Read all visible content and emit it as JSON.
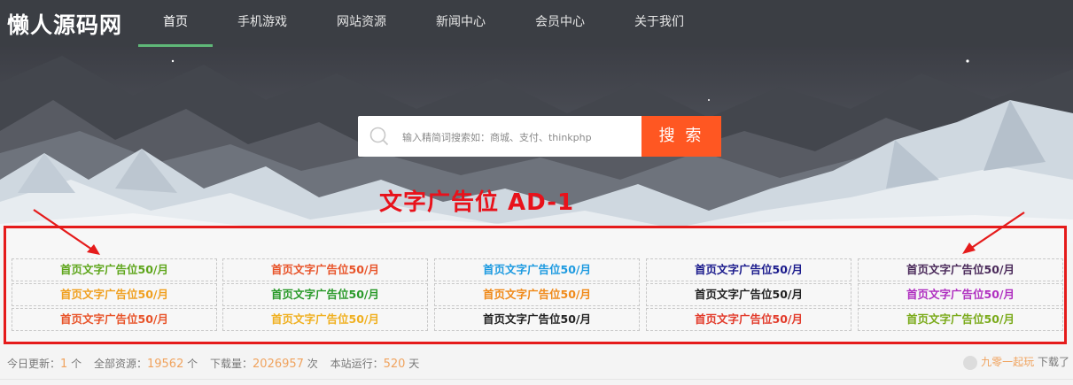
{
  "header": {
    "logo": "懒人源码网",
    "nav": [
      {
        "label": "首页",
        "active": true
      },
      {
        "label": "手机游戏"
      },
      {
        "label": "网站资源"
      },
      {
        "label": "新闻中心"
      },
      {
        "label": "会员中心"
      },
      {
        "label": "关于我们"
      }
    ]
  },
  "search": {
    "placeholder": "输入精简词搜索如：商城、支付、thinkphp",
    "button_label": "搜 索"
  },
  "ad_section": {
    "heading": "文字广告位 AD-1",
    "rows": [
      [
        {
          "text": "首页文字广告位50/月",
          "color": "#5fa61c"
        },
        {
          "text": "首页文字广告位50/月",
          "color": "#e8542a"
        },
        {
          "text": "首页文字广告位50/月",
          "color": "#1c9ae0"
        },
        {
          "text": "首页文字广告位50/月",
          "color": "#1a1a8c"
        },
        {
          "text": "首页文字广告位50/月",
          "color": "#4a2a5a"
        }
      ],
      [
        {
          "text": "首页文字广告位50/月",
          "color": "#f0a020"
        },
        {
          "text": "首页文字广告位50/月",
          "color": "#2a9a2a"
        },
        {
          "text": "首页文字广告位50/月",
          "color": "#f08a1a"
        },
        {
          "text": "首页文字广告位50/月",
          "color": "#222222"
        },
        {
          "text": "首页文字广告位50/月",
          "color": "#b030c0"
        }
      ],
      [
        {
          "text": "首页文字广告位50/月",
          "color": "#e8542a"
        },
        {
          "text": "首页文字广告位50/月",
          "color": "#f0b020"
        },
        {
          "text": "首页文字广告位50/月",
          "color": "#222222"
        },
        {
          "text": "首页文字广告位50/月",
          "color": "#e23a2a"
        },
        {
          "text": "首页文字广告位50/月",
          "color": "#7aaa1a"
        }
      ]
    ]
  },
  "stats": {
    "today_label": "今日更新：",
    "today_value": "1",
    "today_unit": "个",
    "total_label": "全部资源：",
    "total_value": "19562",
    "total_unit": "个",
    "downloads_label": "下载量：",
    "downloads_value": "2026957",
    "downloads_unit": "次",
    "uptime_label": "本站运行：",
    "uptime_value": "520",
    "uptime_unit": "天"
  },
  "recent_user": {
    "name": "九零一起玩",
    "action": "下载了"
  },
  "colors": {
    "nav_bg": "#3b3e44",
    "nav_active_underline": "#5fb878",
    "search_button": "#ff5722",
    "ad_border": "#e51b1b",
    "annotation_red": "#e8121b",
    "stat_number": "#f0a35e"
  }
}
